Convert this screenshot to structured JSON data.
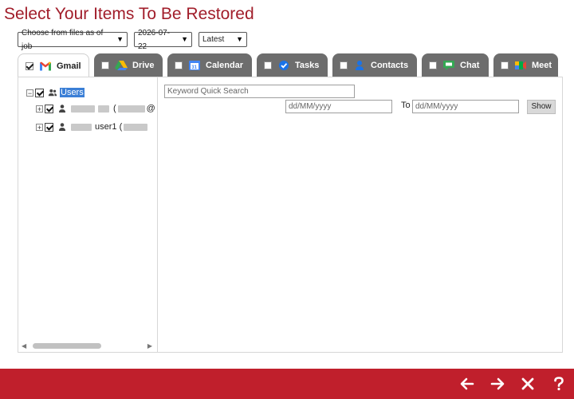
{
  "page": {
    "title": "Select Your Items To Be Restored"
  },
  "filters": {
    "mode": "Choose from files as of job",
    "date": "2026-07-22",
    "version": "Latest"
  },
  "tabs": [
    {
      "label": "Gmail",
      "checked": true,
      "active": true
    },
    {
      "label": "Drive",
      "checked": false
    },
    {
      "label": "Calendar",
      "checked": false
    },
    {
      "label": "Tasks",
      "checked": false
    },
    {
      "label": "Contacts",
      "checked": false
    },
    {
      "label": "Chat",
      "checked": false
    },
    {
      "label": "Meet",
      "checked": false
    }
  ],
  "tree": {
    "root": {
      "label": "Users"
    },
    "items": [
      {
        "label": "(",
        "suffix": "@"
      },
      {
        "label": "user1 (",
        "suffix": ""
      }
    ]
  },
  "search": {
    "keyword_placeholder": "Keyword Quick Search",
    "from_placeholder": "dd/MM/yyyy",
    "to_label": "To",
    "to_placeholder": "dd/MM/yyyy",
    "show_label": "Show"
  },
  "colors": {
    "brand": "#c01f2c",
    "title": "#a11d2a",
    "tab": "#6d6d6d",
    "selection": "#3b7fd6"
  },
  "footer": {
    "icons": [
      "arrow-left-icon",
      "arrow-right-icon",
      "close-icon",
      "help-icon"
    ]
  }
}
